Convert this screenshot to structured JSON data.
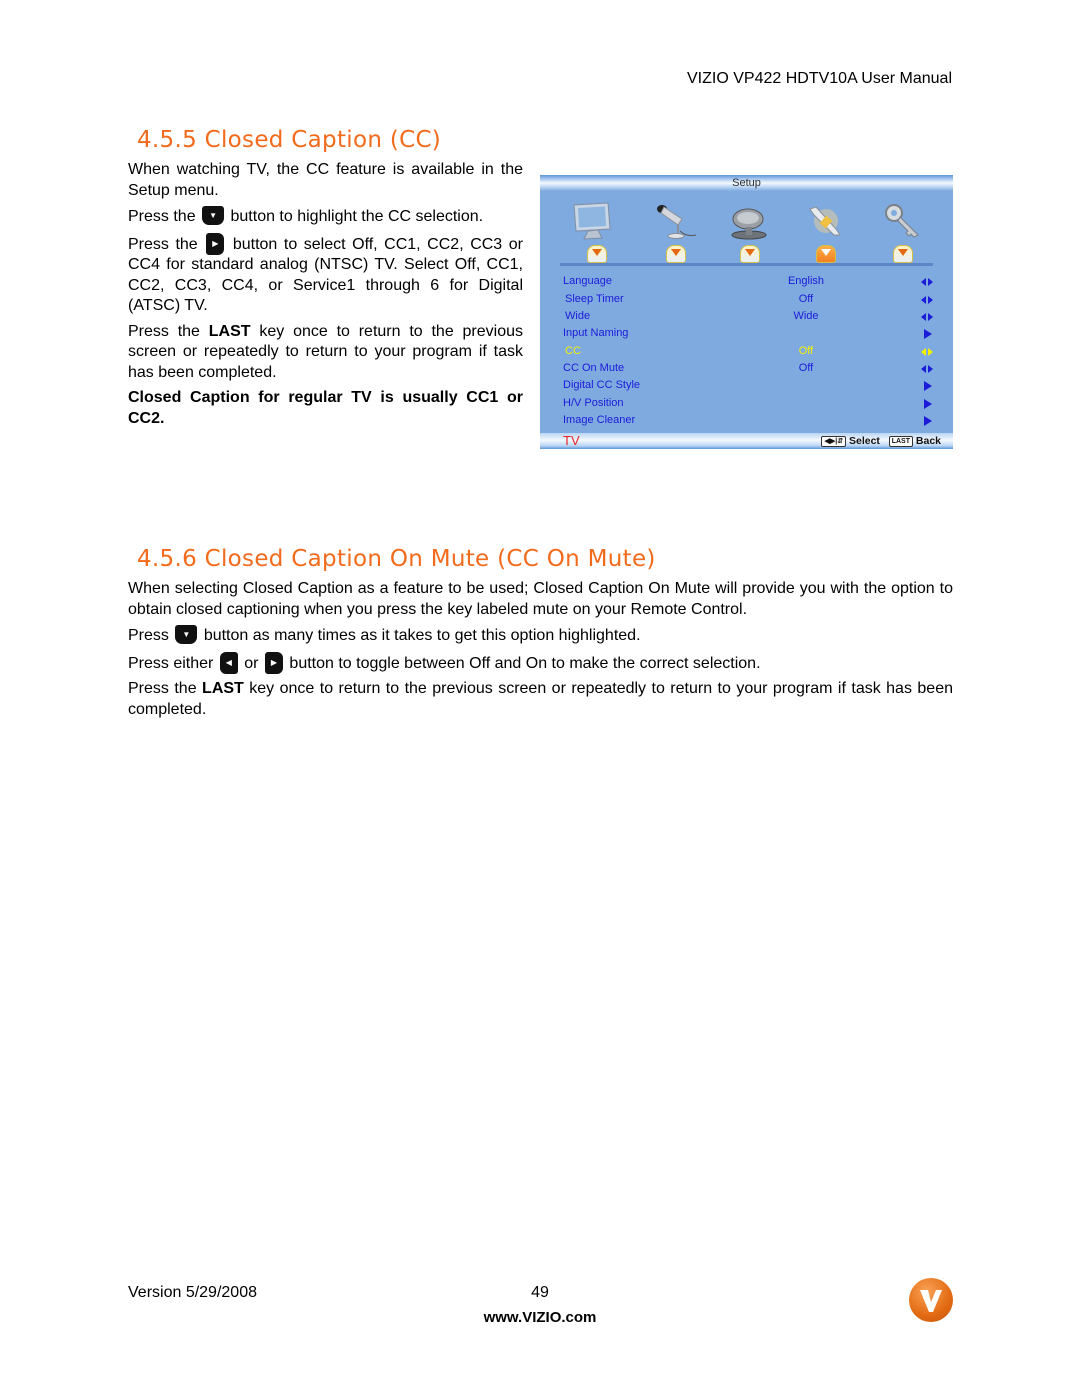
{
  "header": {
    "manual_title": "VIZIO VP422 HDTV10A User Manual"
  },
  "section_455": {
    "heading": "4.5.5 Closed Caption (CC)",
    "para1": "When watching TV, the CC feature is available in the Setup menu.",
    "para2_before": "Press the",
    "para2_after": "button to highlight the CC selection.",
    "para3_before": "Press the",
    "para3_after": "button to select Off, CC1, CC2, CC3 or CC4 for standard analog (NTSC) TV. Select Off, CC1, CC2, CC3, CC4, or Service1 through 6 for Digital (ATSC) TV.",
    "para4_before": "Press the",
    "para4_key": "LAST",
    "para4_after": "key once to return to the previous screen or repeatedly to return to your program if task has been completed.",
    "note": "Closed Caption for regular TV is usually CC1 or CC2."
  },
  "osd": {
    "title": "Setup",
    "icons": [
      "monitor-icon",
      "microphone-icon",
      "satellite-dish-icon",
      "wrench-icon",
      "key-icon"
    ],
    "active_tab_index": 3,
    "rows": [
      {
        "label": "Language",
        "value": "English",
        "arrow": "left-right",
        "selected": false
      },
      {
        "label": "Sleep Timer",
        "value": "Off",
        "arrow": "left-right",
        "selected": false
      },
      {
        "label": "Wide",
        "value": "Wide",
        "arrow": "left-right",
        "selected": false
      },
      {
        "label": "Input Naming",
        "value": "",
        "arrow": "right",
        "selected": false
      },
      {
        "label": "CC",
        "value": "Off",
        "arrow": "left-right",
        "selected": true
      },
      {
        "label": "CC On Mute",
        "value": "Off",
        "arrow": "left-right",
        "selected": false
      },
      {
        "label": "Digital CC Style",
        "value": "",
        "arrow": "right",
        "selected": false
      },
      {
        "label": "H/V Position",
        "value": "",
        "arrow": "right",
        "selected": false
      },
      {
        "label": "Image Cleaner",
        "value": "",
        "arrow": "right",
        "selected": false
      }
    ],
    "source": "TV",
    "hint_select": "Select",
    "hint_last_key": "LAST",
    "hint_back": "Back"
  },
  "section_456": {
    "heading": "4.5.6 Closed Caption On Mute (CC On Mute)",
    "para1": "When selecting Closed Caption as a feature to be used; Closed Caption On Mute will provide you with the option to obtain closed captioning when you press the key labeled mute on your Remote Control.",
    "para2_before": "Press",
    "para2_after": "button as many times as it takes to get this option highlighted.",
    "para3_before": "Press either",
    "para3_mid": "or",
    "para3_after": "button to toggle between Off and On to make the correct selection.",
    "para4_before": "Press the",
    "para4_key": "LAST",
    "para4_after": "key once to return to the previous screen or repeatedly to return to your program if task has been completed."
  },
  "footer": {
    "version": "Version 5/29/2008",
    "page_number": "49",
    "url": "www.VIZIO.com"
  },
  "colors": {
    "heading": "#f26a1b",
    "osd_bg": "#7faae0",
    "osd_text": "#1b1bd8",
    "osd_selected": "#f4f000",
    "osd_source": "#e8262a"
  }
}
